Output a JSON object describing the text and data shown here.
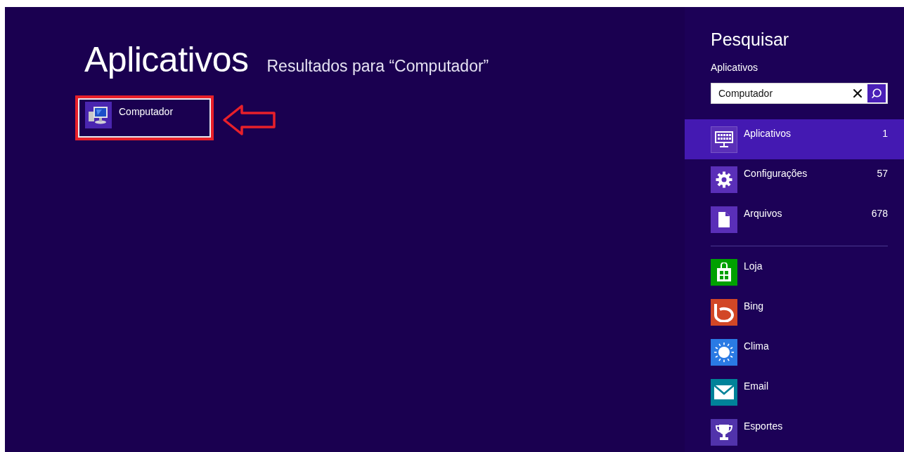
{
  "main": {
    "title": "Aplicativos",
    "subtitle": "Resultados para “Computador”",
    "results": [
      {
        "label": "Computador",
        "selected": true
      }
    ]
  },
  "search_pane": {
    "title": "Pesquisar",
    "scope": "Aplicativos",
    "query": "Computador",
    "categories": [
      {
        "kind": "apps",
        "label": "Aplicativos",
        "count": "1",
        "selected": true
      },
      {
        "kind": "settings",
        "label": "Configurações",
        "count": "57",
        "selected": false
      },
      {
        "kind": "files",
        "label": "Arquivos",
        "count": "678",
        "selected": false
      }
    ],
    "apps": [
      {
        "kind": "store",
        "label": "Loja",
        "color": "#00a000"
      },
      {
        "kind": "bing",
        "label": "Bing",
        "color": "#d24726"
      },
      {
        "kind": "weather",
        "label": "Clima",
        "color": "#2a7ae4"
      },
      {
        "kind": "mail",
        "label": "Email",
        "color": "#008299"
      },
      {
        "kind": "trophy",
        "label": "Esportes",
        "color": "#5133ab"
      }
    ]
  }
}
